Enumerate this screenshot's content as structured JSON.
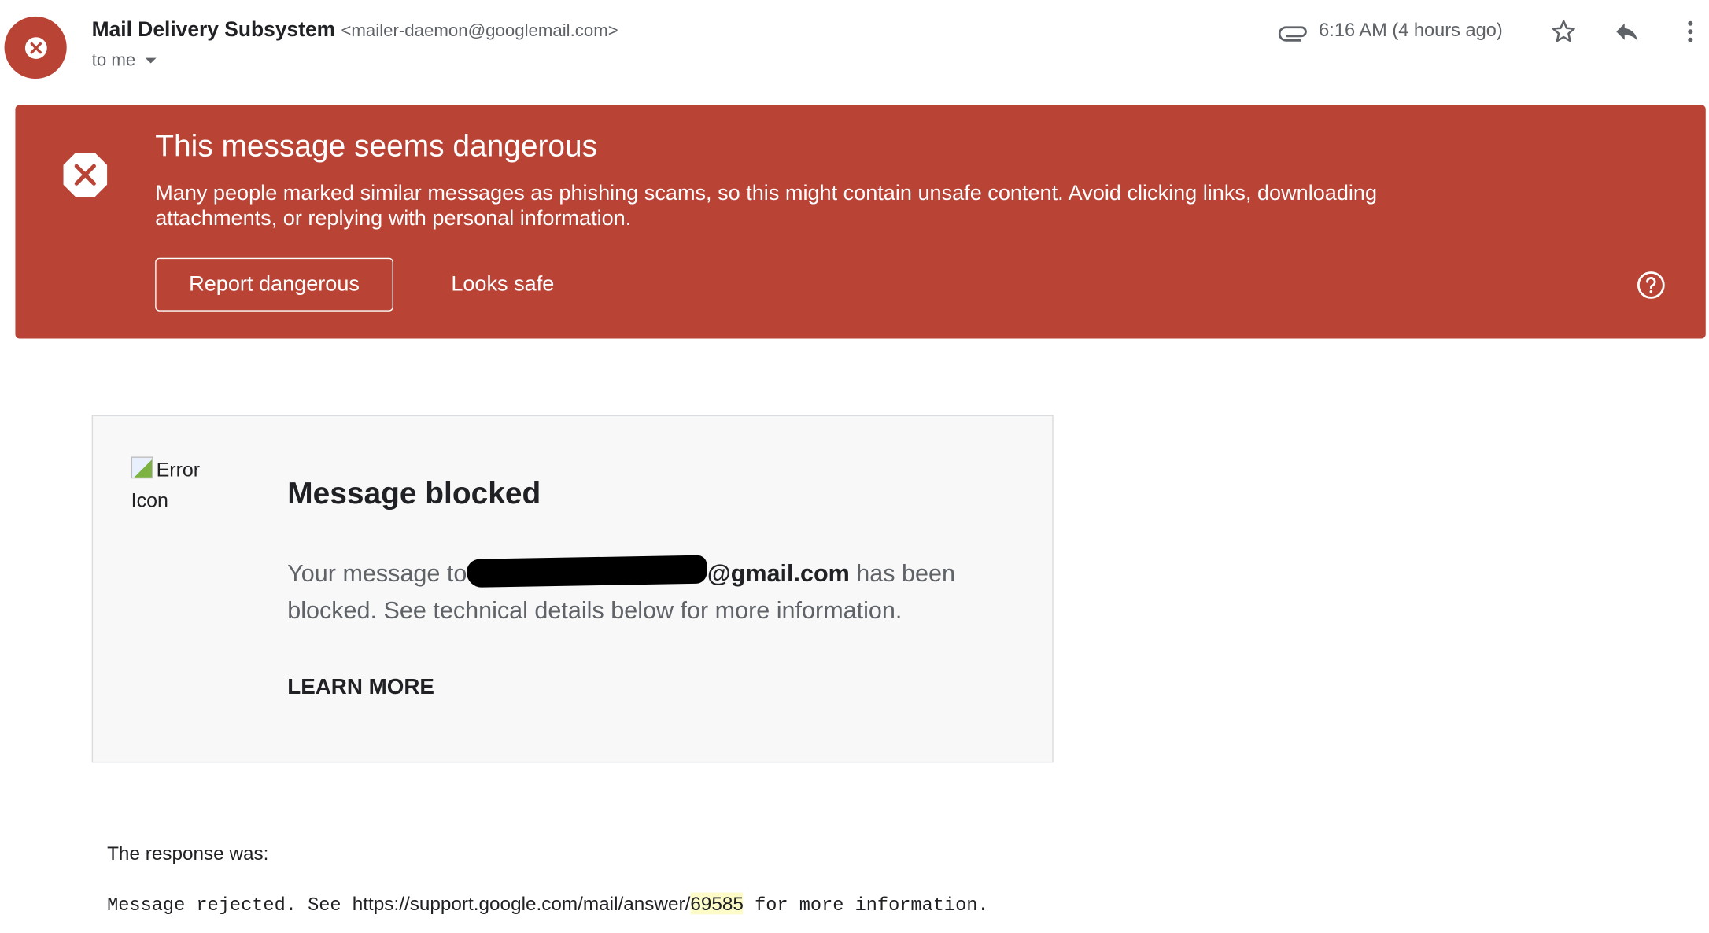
{
  "sender": {
    "name": "Mail Delivery Subsystem",
    "email": "<mailer-daemon@googlemail.com>",
    "recipient_label": "to me",
    "avatar_icon": "error-x-icon"
  },
  "header": {
    "timestamp": "6:16 AM (4 hours ago)",
    "icons": [
      "paperclip-icon",
      "star-icon",
      "reply-icon",
      "more-vertical-icon"
    ]
  },
  "warning": {
    "title": "This message seems dangerous",
    "body": "Many people marked similar messages as phishing scams, so this might contain unsafe content. Avoid clicking links, downloading attachments, or replying with personal information.",
    "report_label": "Report dangerous",
    "safe_label": "Looks safe",
    "color": "#b94436"
  },
  "card": {
    "broken_image_alt": "Error Icon",
    "title": "Message blocked",
    "body_prefix": "Your message to",
    "redacted_domain": "@gmail.com",
    "body_suffix": " has been blocked. See technical details below for more information.",
    "learn_more": "LEARN MORE"
  },
  "response": {
    "label": "The response was:",
    "line_prefix": "Message rejected. See ",
    "link_base": "https://support.google.com/mail/answer/",
    "link_id": "69585",
    "line_suffix": " for more information."
  }
}
